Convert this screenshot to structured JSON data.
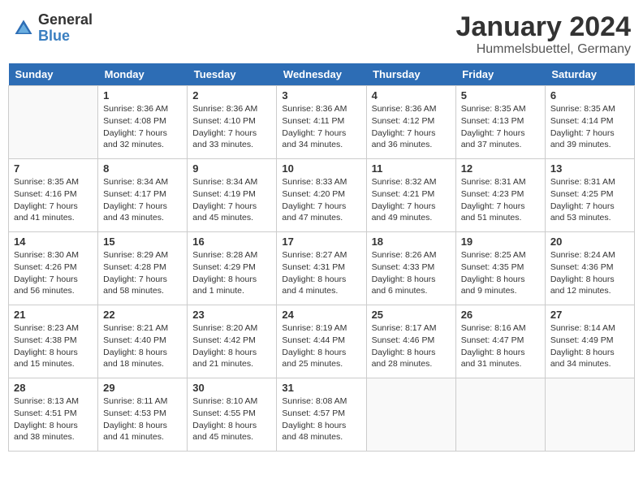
{
  "logo": {
    "general": "General",
    "blue": "Blue"
  },
  "calendar": {
    "title": "January 2024",
    "subtitle": "Hummelsbuettel, Germany",
    "days_of_week": [
      "Sunday",
      "Monday",
      "Tuesday",
      "Wednesday",
      "Thursday",
      "Friday",
      "Saturday"
    ],
    "weeks": [
      [
        {
          "day": "",
          "sunrise": "",
          "sunset": "",
          "daylight": ""
        },
        {
          "day": "1",
          "sunrise": "Sunrise: 8:36 AM",
          "sunset": "Sunset: 4:08 PM",
          "daylight": "Daylight: 7 hours and 32 minutes."
        },
        {
          "day": "2",
          "sunrise": "Sunrise: 8:36 AM",
          "sunset": "Sunset: 4:10 PM",
          "daylight": "Daylight: 7 hours and 33 minutes."
        },
        {
          "day": "3",
          "sunrise": "Sunrise: 8:36 AM",
          "sunset": "Sunset: 4:11 PM",
          "daylight": "Daylight: 7 hours and 34 minutes."
        },
        {
          "day": "4",
          "sunrise": "Sunrise: 8:36 AM",
          "sunset": "Sunset: 4:12 PM",
          "daylight": "Daylight: 7 hours and 36 minutes."
        },
        {
          "day": "5",
          "sunrise": "Sunrise: 8:35 AM",
          "sunset": "Sunset: 4:13 PM",
          "daylight": "Daylight: 7 hours and 37 minutes."
        },
        {
          "day": "6",
          "sunrise": "Sunrise: 8:35 AM",
          "sunset": "Sunset: 4:14 PM",
          "daylight": "Daylight: 7 hours and 39 minutes."
        }
      ],
      [
        {
          "day": "7",
          "sunrise": "Sunrise: 8:35 AM",
          "sunset": "Sunset: 4:16 PM",
          "daylight": "Daylight: 7 hours and 41 minutes."
        },
        {
          "day": "8",
          "sunrise": "Sunrise: 8:34 AM",
          "sunset": "Sunset: 4:17 PM",
          "daylight": "Daylight: 7 hours and 43 minutes."
        },
        {
          "day": "9",
          "sunrise": "Sunrise: 8:34 AM",
          "sunset": "Sunset: 4:19 PM",
          "daylight": "Daylight: 7 hours and 45 minutes."
        },
        {
          "day": "10",
          "sunrise": "Sunrise: 8:33 AM",
          "sunset": "Sunset: 4:20 PM",
          "daylight": "Daylight: 7 hours and 47 minutes."
        },
        {
          "day": "11",
          "sunrise": "Sunrise: 8:32 AM",
          "sunset": "Sunset: 4:21 PM",
          "daylight": "Daylight: 7 hours and 49 minutes."
        },
        {
          "day": "12",
          "sunrise": "Sunrise: 8:31 AM",
          "sunset": "Sunset: 4:23 PM",
          "daylight": "Daylight: 7 hours and 51 minutes."
        },
        {
          "day": "13",
          "sunrise": "Sunrise: 8:31 AM",
          "sunset": "Sunset: 4:25 PM",
          "daylight": "Daylight: 7 hours and 53 minutes."
        }
      ],
      [
        {
          "day": "14",
          "sunrise": "Sunrise: 8:30 AM",
          "sunset": "Sunset: 4:26 PM",
          "daylight": "Daylight: 7 hours and 56 minutes."
        },
        {
          "day": "15",
          "sunrise": "Sunrise: 8:29 AM",
          "sunset": "Sunset: 4:28 PM",
          "daylight": "Daylight: 7 hours and 58 minutes."
        },
        {
          "day": "16",
          "sunrise": "Sunrise: 8:28 AM",
          "sunset": "Sunset: 4:29 PM",
          "daylight": "Daylight: 8 hours and 1 minute."
        },
        {
          "day": "17",
          "sunrise": "Sunrise: 8:27 AM",
          "sunset": "Sunset: 4:31 PM",
          "daylight": "Daylight: 8 hours and 4 minutes."
        },
        {
          "day": "18",
          "sunrise": "Sunrise: 8:26 AM",
          "sunset": "Sunset: 4:33 PM",
          "daylight": "Daylight: 8 hours and 6 minutes."
        },
        {
          "day": "19",
          "sunrise": "Sunrise: 8:25 AM",
          "sunset": "Sunset: 4:35 PM",
          "daylight": "Daylight: 8 hours and 9 minutes."
        },
        {
          "day": "20",
          "sunrise": "Sunrise: 8:24 AM",
          "sunset": "Sunset: 4:36 PM",
          "daylight": "Daylight: 8 hours and 12 minutes."
        }
      ],
      [
        {
          "day": "21",
          "sunrise": "Sunrise: 8:23 AM",
          "sunset": "Sunset: 4:38 PM",
          "daylight": "Daylight: 8 hours and 15 minutes."
        },
        {
          "day": "22",
          "sunrise": "Sunrise: 8:21 AM",
          "sunset": "Sunset: 4:40 PM",
          "daylight": "Daylight: 8 hours and 18 minutes."
        },
        {
          "day": "23",
          "sunrise": "Sunrise: 8:20 AM",
          "sunset": "Sunset: 4:42 PM",
          "daylight": "Daylight: 8 hours and 21 minutes."
        },
        {
          "day": "24",
          "sunrise": "Sunrise: 8:19 AM",
          "sunset": "Sunset: 4:44 PM",
          "daylight": "Daylight: 8 hours and 25 minutes."
        },
        {
          "day": "25",
          "sunrise": "Sunrise: 8:17 AM",
          "sunset": "Sunset: 4:46 PM",
          "daylight": "Daylight: 8 hours and 28 minutes."
        },
        {
          "day": "26",
          "sunrise": "Sunrise: 8:16 AM",
          "sunset": "Sunset: 4:47 PM",
          "daylight": "Daylight: 8 hours and 31 minutes."
        },
        {
          "day": "27",
          "sunrise": "Sunrise: 8:14 AM",
          "sunset": "Sunset: 4:49 PM",
          "daylight": "Daylight: 8 hours and 34 minutes."
        }
      ],
      [
        {
          "day": "28",
          "sunrise": "Sunrise: 8:13 AM",
          "sunset": "Sunset: 4:51 PM",
          "daylight": "Daylight: 8 hours and 38 minutes."
        },
        {
          "day": "29",
          "sunrise": "Sunrise: 8:11 AM",
          "sunset": "Sunset: 4:53 PM",
          "daylight": "Daylight: 8 hours and 41 minutes."
        },
        {
          "day": "30",
          "sunrise": "Sunrise: 8:10 AM",
          "sunset": "Sunset: 4:55 PM",
          "daylight": "Daylight: 8 hours and 45 minutes."
        },
        {
          "day": "31",
          "sunrise": "Sunrise: 8:08 AM",
          "sunset": "Sunset: 4:57 PM",
          "daylight": "Daylight: 8 hours and 48 minutes."
        },
        {
          "day": "",
          "sunrise": "",
          "sunset": "",
          "daylight": ""
        },
        {
          "day": "",
          "sunrise": "",
          "sunset": "",
          "daylight": ""
        },
        {
          "day": "",
          "sunrise": "",
          "sunset": "",
          "daylight": ""
        }
      ]
    ]
  }
}
